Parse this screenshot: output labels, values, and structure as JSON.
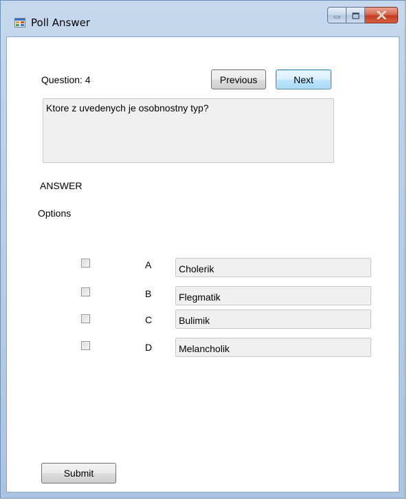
{
  "window": {
    "title": "Poll Answer",
    "minimize_glyph": "‒",
    "maximize_glyph": "□",
    "close_glyph": "✕"
  },
  "question": {
    "label": "Question: 4",
    "text": "Ktore z uvedenych je osobnostny typ?"
  },
  "nav": {
    "previous_label": "Previous",
    "next_label": "Next"
  },
  "answer_heading": "ANSWER",
  "options_heading": "Options",
  "options": [
    {
      "letter": "A",
      "value": "Cholerik",
      "checked": false
    },
    {
      "letter": "B",
      "value": "Flegmatik",
      "checked": false
    },
    {
      "letter": "C",
      "value": "Bulimik",
      "checked": false
    },
    {
      "letter": "D",
      "value": "Melancholik",
      "checked": false
    }
  ],
  "submit_label": "Submit",
  "icons": {
    "app": "form-app-icon",
    "minimize": "minimize-icon",
    "maximize": "maximize-icon",
    "close": "close-icon"
  },
  "colors": {
    "accent": "#3c7fb1",
    "close_button": "#c43c1e",
    "field_background": "#f0f0f0"
  }
}
